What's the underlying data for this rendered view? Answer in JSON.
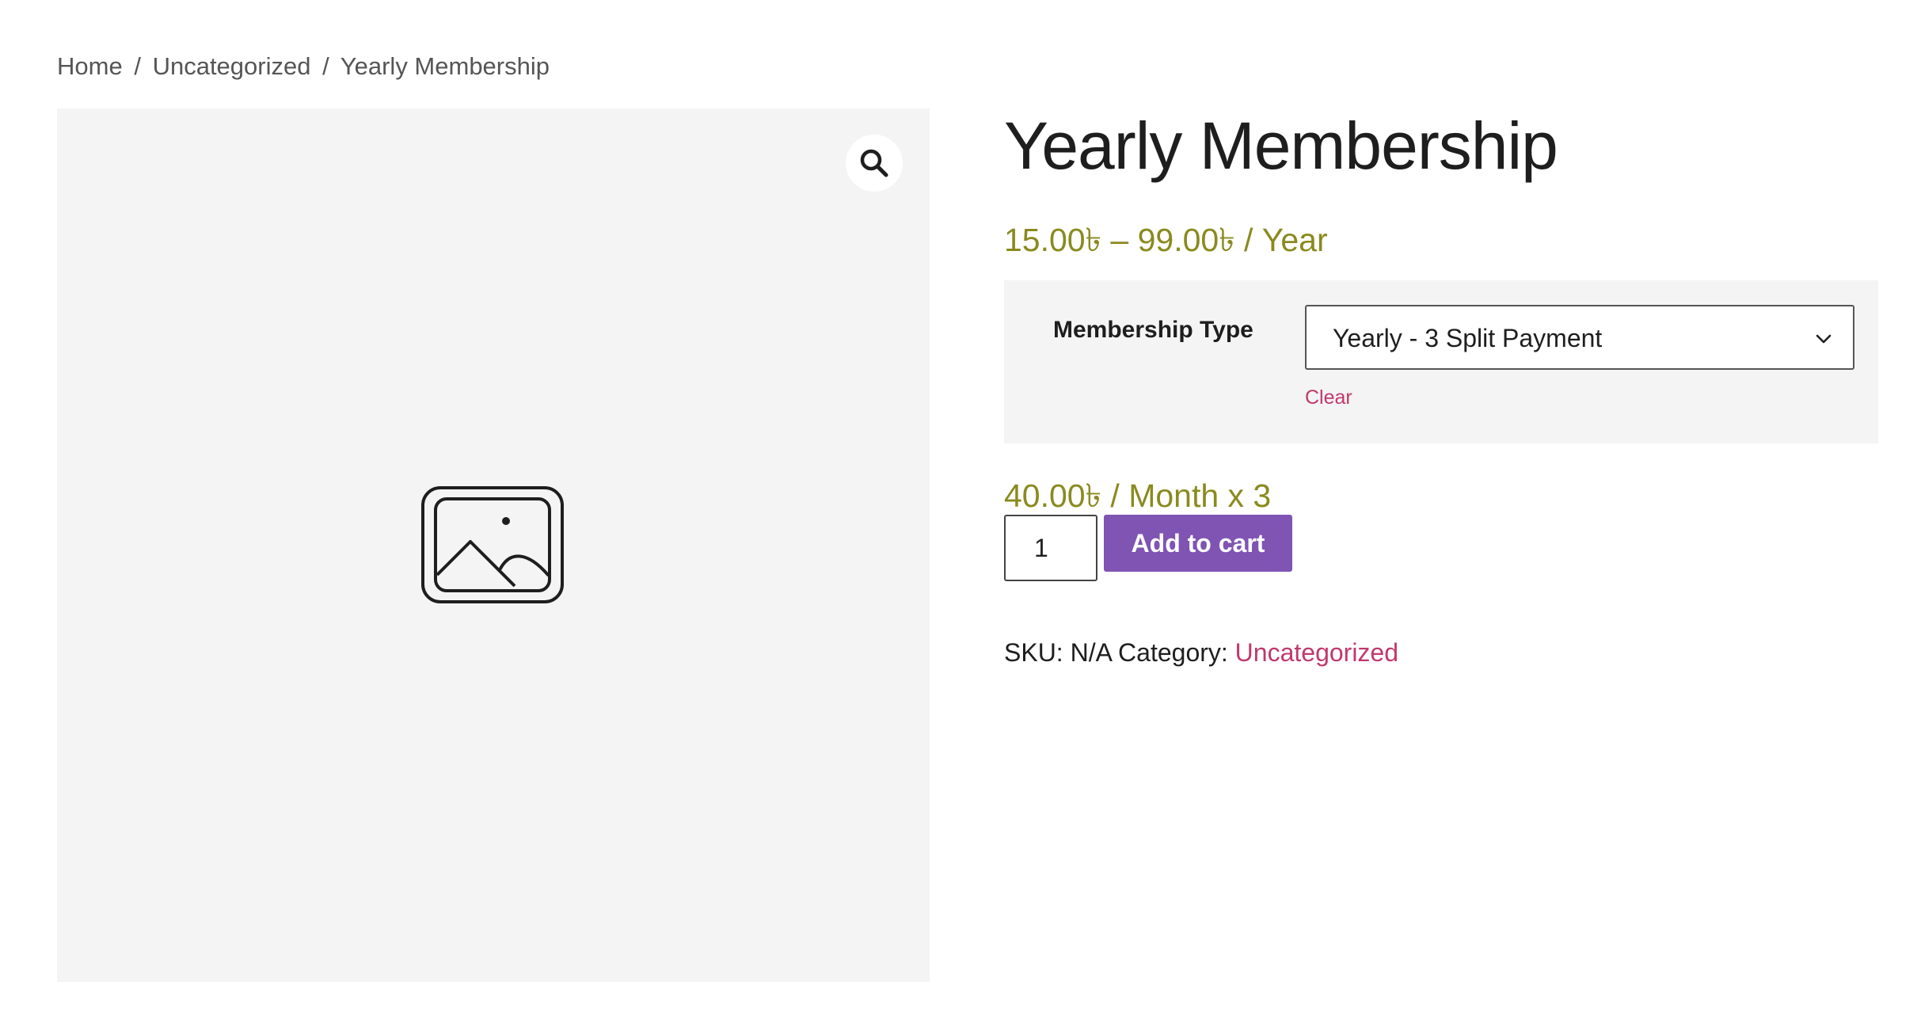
{
  "breadcrumb": {
    "home": "Home",
    "separator": "/",
    "category": "Uncategorized",
    "current": "Yearly Membership"
  },
  "gallery": {
    "zoom_icon": "magnifier-icon",
    "placeholder_icon": "image-placeholder-icon"
  },
  "product": {
    "title": "Yearly Membership",
    "price_range": "15.00৳  – 99.00৳  / Year",
    "variation": {
      "label": "Membership Type",
      "selected": "Yearly - 3 Split Payment",
      "clear_label": "Clear"
    },
    "variation_price": "40.00৳  / Month x 3",
    "quantity": "1",
    "add_to_cart_label": "Add to cart",
    "meta": {
      "sku_label": "SKU:",
      "sku_value": "N/A",
      "category_label": "Category:",
      "category_value": "Uncategorized"
    }
  },
  "colors": {
    "price": "#8a8a1f",
    "link": "#c0396b",
    "button": "#7f54b3",
    "panel": "#f4f4f4"
  }
}
